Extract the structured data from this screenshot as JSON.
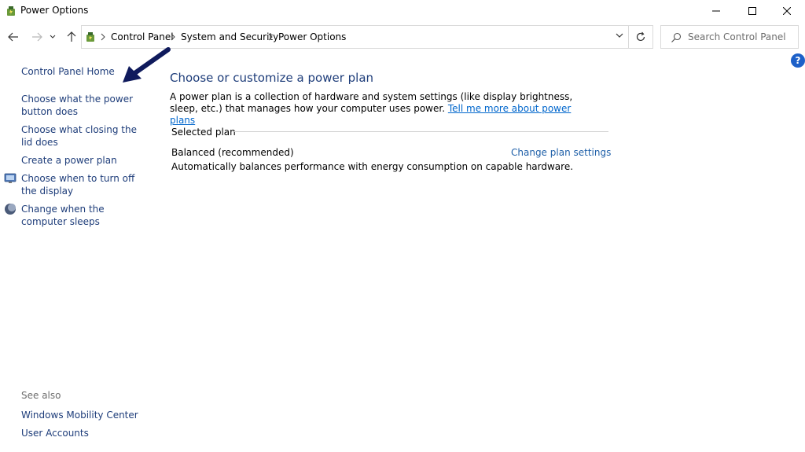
{
  "window": {
    "title": "Power Options"
  },
  "nav": {
    "breadcrumbs": [
      "Control Panel",
      "System and Security",
      "Power Options"
    ]
  },
  "search": {
    "placeholder": "Search Control Panel"
  },
  "help": {
    "glyph": "?"
  },
  "sidebar": {
    "home": "Control Panel Home",
    "items": [
      {
        "label": "Choose what the power button does"
      },
      {
        "label": "Choose what closing the lid does"
      },
      {
        "label": "Create a power plan"
      },
      {
        "label": "Choose when to turn off the display",
        "icon": "display-icon"
      },
      {
        "label": "Change when the computer sleeps",
        "icon": "moon-icon"
      }
    ],
    "see_also_heading": "See also",
    "see_also": [
      "Windows Mobility Center",
      "User Accounts"
    ]
  },
  "main": {
    "title": "Choose or customize a power plan",
    "description": "A power plan is a collection of hardware and system settings (like display brightness, sleep, etc.) that manages how your computer uses power.",
    "learn_more": "Tell me more about power plans",
    "section_label": "Selected plan",
    "plan": {
      "name": "Balanced (recommended)",
      "change_link": "Change plan settings",
      "description": "Automatically balances performance with energy consumption on capable hardware."
    }
  },
  "colors": {
    "link": "#1e3d7a",
    "accent_link": "#0066cc",
    "annotation_arrow": "#0f1a5c"
  }
}
